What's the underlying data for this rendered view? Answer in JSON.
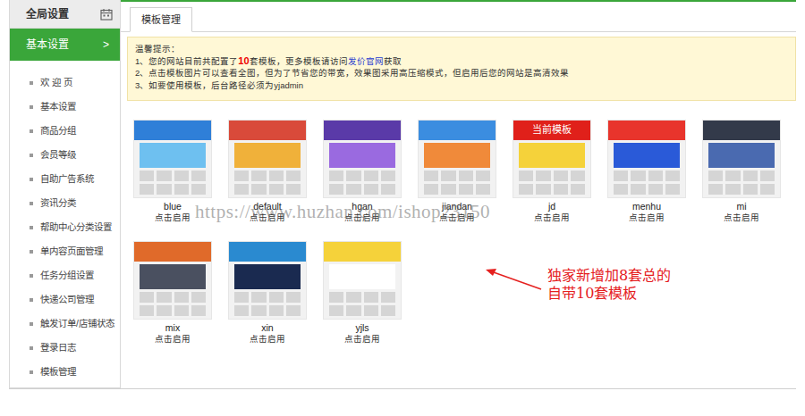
{
  "sidebar": {
    "title": "全局设置",
    "section": {
      "label": "基本设置",
      "arrow": ">"
    },
    "items": [
      {
        "label": "欢 迎 页"
      },
      {
        "label": "基本设置"
      },
      {
        "label": "商品分组"
      },
      {
        "label": "会员等级"
      },
      {
        "label": "自助广告系统"
      },
      {
        "label": "资讯分类"
      },
      {
        "label": "帮助中心分类设置"
      },
      {
        "label": "单内容页面管理"
      },
      {
        "label": "任务分组设置"
      },
      {
        "label": "快递公司管理"
      },
      {
        "label": "触发订单/店铺状态"
      },
      {
        "label": "登录日志"
      },
      {
        "label": "模板管理"
      }
    ]
  },
  "tabs": [
    {
      "label": "模板管理",
      "selected": true
    }
  ],
  "notice": {
    "title": "温馨提示：",
    "lines": [
      [
        {
          "kind": "text",
          "text": "1、您的网站目前共配置了"
        },
        {
          "kind": "count",
          "text": "10"
        },
        {
          "kind": "text",
          "text": "套模板，更多模板请访问"
        },
        {
          "kind": "link",
          "text": "发价官网"
        },
        {
          "kind": "text",
          "text": "获取"
        }
      ],
      [
        {
          "kind": "text",
          "text": "2、点击模板图片可以查看全图，但为了节省您的带宽，效果图采用高压缩模式，但启用后您的网站是高清效果"
        }
      ],
      [
        {
          "kind": "text",
          "text": "3、如要使用模板，后台路径必须为yjadmin"
        }
      ]
    ]
  },
  "current_badge": "当前模板",
  "templates": [
    {
      "name": "blue",
      "action": "点击启用",
      "current": false
    },
    {
      "name": "default",
      "action": "点击启用",
      "current": false
    },
    {
      "name": "hgan",
      "action": "点击启用",
      "current": false
    },
    {
      "name": "jiandan",
      "action": "点击启用",
      "current": false
    },
    {
      "name": "jd",
      "action": "点击启用",
      "current": true
    },
    {
      "name": "menhu",
      "action": "点击启用",
      "current": false
    },
    {
      "name": "mi",
      "action": "点击启用",
      "current": false
    },
    {
      "name": "mix",
      "action": "点击启用",
      "current": false
    },
    {
      "name": "xin",
      "action": "点击启用",
      "current": false
    },
    {
      "name": "yjls",
      "action": "点击启用",
      "current": false
    }
  ],
  "annotation": [
    "独家新增加8套总的",
    "自带10套模板"
  ],
  "watermark": "https://www.huzhan.com/ishop23150"
}
